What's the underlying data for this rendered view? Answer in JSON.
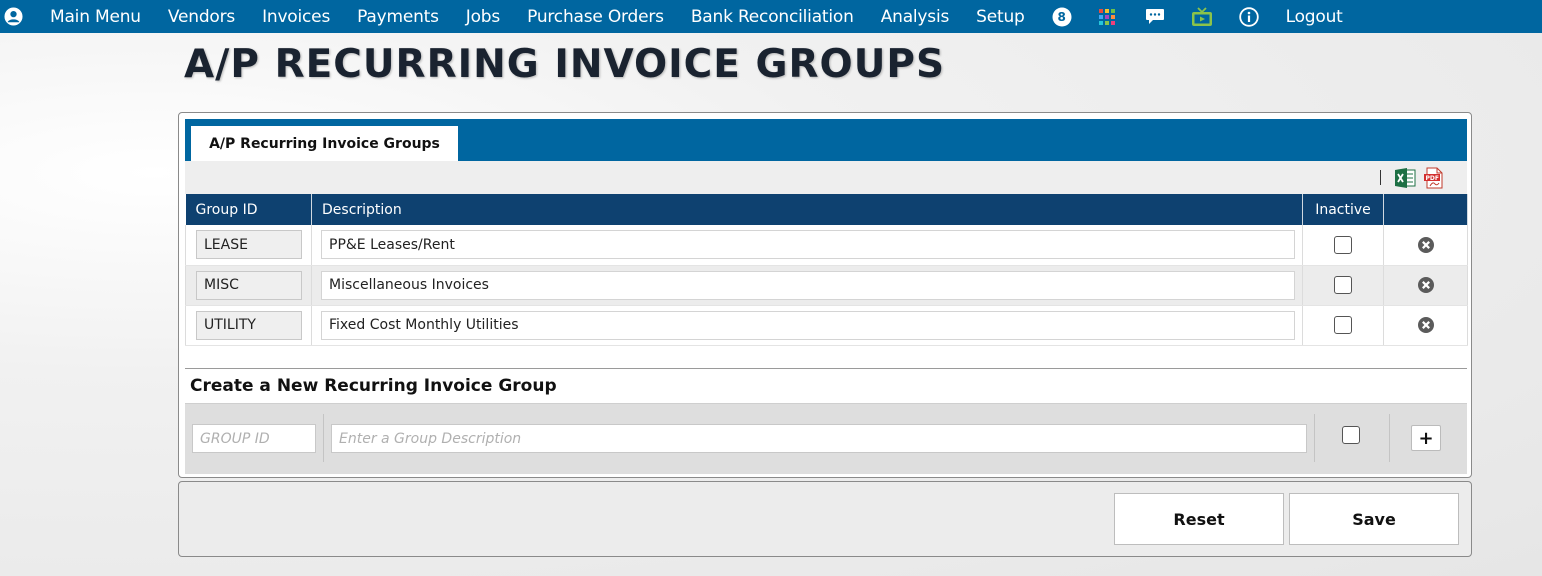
{
  "nav": {
    "items": [
      "Main Menu",
      "Vendors",
      "Invoices",
      "Payments",
      "Jobs",
      "Purchase Orders",
      "Bank Reconciliation",
      "Analysis",
      "Setup"
    ],
    "badge_count": "8",
    "logout": "Logout",
    "icons": [
      "user-icon",
      "notification-badge-icon",
      "apps-grid-icon",
      "chat-icon",
      "tv-icon",
      "info-icon"
    ]
  },
  "page_title": "A/P RECURRING INVOICE GROUPS",
  "tab_label": "A/P Recurring Invoice Groups",
  "toolbar": {
    "export_icons": [
      "excel-icon",
      "pdf-icon"
    ]
  },
  "table": {
    "headers": [
      "Group ID",
      "Description",
      "Inactive",
      ""
    ],
    "rows": [
      {
        "group_id": "LEASE",
        "description": "PP&E Leases/Rent",
        "inactive": false
      },
      {
        "group_id": "MISC",
        "description": "Miscellaneous Invoices",
        "inactive": false
      },
      {
        "group_id": "UTILITY",
        "description": "Fixed Cost Monthly Utilities",
        "inactive": false
      }
    ]
  },
  "new_group": {
    "heading": "Create a New Recurring Invoice Group",
    "group_id_placeholder": "GROUP ID",
    "description_placeholder": "Enter a Group Description",
    "add_label": "+"
  },
  "buttons": {
    "reset": "Reset",
    "save": "Save"
  },
  "colors": {
    "nav_bg": "#0066a0",
    "table_header_bg": "#0e4170"
  }
}
